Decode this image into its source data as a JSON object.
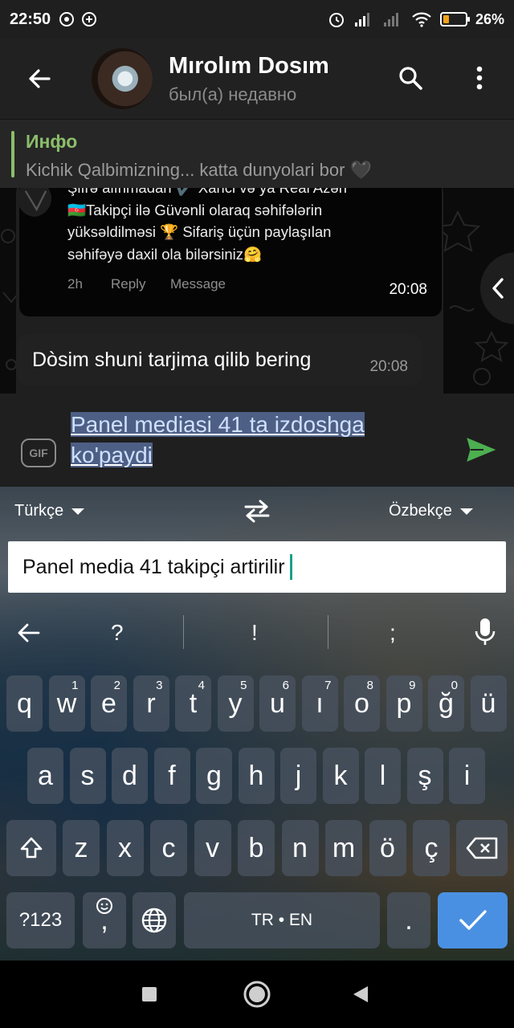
{
  "status_bar": {
    "time": "22:50",
    "battery": "26%",
    "battery_level": 0.26
  },
  "header": {
    "name": "Mırolım Dosım",
    "last_seen": "был(а) недавно"
  },
  "pinned": {
    "title": "Инфо",
    "text": "Kichik Qalbimizning... katta dunyolari bor 🖤"
  },
  "messages": {
    "forwarded": {
      "lines": [
        "Şifrə alınmadan ✔️ Xarici və ya Real Azəri",
        "🇦🇿Takipçi ilə Güvənli olaraq səhifələrin",
        "yüksəldilməsi 🏆 Sifariş üçün paylaşılan",
        "səhifəyə daxil ola bilərsiniz🤗"
      ],
      "age": "2h",
      "reply": "Reply",
      "message": "Message",
      "time": "20:08"
    },
    "incoming": {
      "text": "Dòsim shuni tarjima qilib bering",
      "time": "20:08"
    }
  },
  "composer": {
    "gif_label": "GIF",
    "text_line1": "Panel mediasi 41 ta izdoshga",
    "text_line2": "ko'paydi"
  },
  "keyboard": {
    "source_lang": "Türkçe",
    "target_lang": "Özbekçe",
    "translation_input": "Panel media 41 takipçi artirilir",
    "suggestions": [
      "?",
      "!",
      ";"
    ],
    "row1": [
      [
        "q",
        ""
      ],
      [
        "w",
        "1"
      ],
      [
        "e",
        "2"
      ],
      [
        "r",
        "3"
      ],
      [
        "t",
        "4"
      ],
      [
        "y",
        "5"
      ],
      [
        "u",
        "6"
      ],
      [
        "ı",
        "7"
      ],
      [
        "o",
        "8"
      ],
      [
        "p",
        "9"
      ],
      [
        "ğ",
        "0"
      ],
      [
        "ü",
        ""
      ]
    ],
    "row2": [
      "a",
      "s",
      "d",
      "f",
      "g",
      "h",
      "j",
      "k",
      "l",
      "ş",
      "i"
    ],
    "row3": [
      "z",
      "x",
      "c",
      "v",
      "b",
      "n",
      "m",
      "ö",
      "ç"
    ],
    "symbols_key": "?123",
    "comma_key": ",",
    "space_label": "TR • EN",
    "period_key": "."
  },
  "colors": {
    "accent_green": "#8bbe6a",
    "send_green": "#4caf50",
    "selection": "#4e5f85",
    "keyboard_ok": "#4a90e2"
  }
}
